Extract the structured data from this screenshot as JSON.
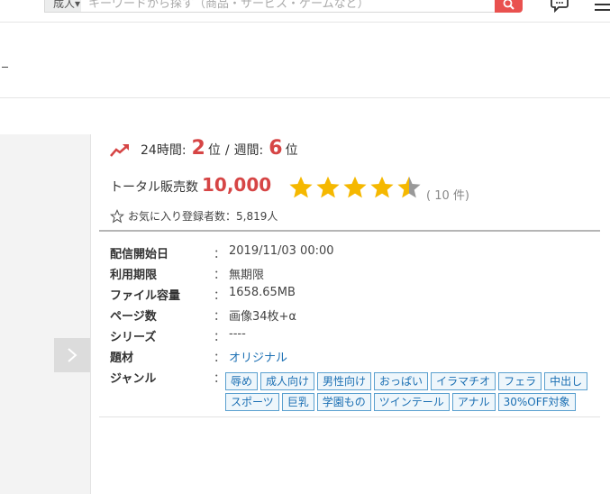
{
  "header": {
    "scope_label": "成人▾",
    "search_placeholder": "キーワードから探す（商品・サービス・ゲームなど）"
  },
  "ranking": {
    "label_24h": "24時間:",
    "rank_24h": "2",
    "unit": "位",
    "separator": "/",
    "label_week": "週間:",
    "rank_week": "6"
  },
  "sales": {
    "label": "トータル販売数",
    "value": "10,000"
  },
  "rating": {
    "stars": 4.5,
    "max_stars": 5,
    "review_count_text": "( 10 件)",
    "star_color": "#f5b800"
  },
  "favorites": {
    "text": "お気に入り登録者数：5,819人"
  },
  "details": {
    "colon": "：",
    "rows": [
      {
        "key": "配信開始日",
        "value": "2019/11/03 00:00"
      },
      {
        "key": "利用期限",
        "value": "無期限"
      },
      {
        "key": "ファイル容量",
        "value": "1658.65MB"
      },
      {
        "key": "ページ数",
        "value": "画像34枚+α"
      },
      {
        "key": "シリーズ",
        "value": "----"
      },
      {
        "key": "題材",
        "value": "オリジナル"
      },
      {
        "key": "ジャンル",
        "value": ""
      }
    ]
  },
  "genres": [
    "辱め",
    "成人向け",
    "男性向け",
    "おっぱい",
    "イラマチオ",
    "フェラ",
    "中出し",
    "スポーツ",
    "巨乳",
    "学園もの",
    "ツインテール",
    "アナル",
    "30%OFF対象"
  ],
  "colors": {
    "accent_red": "#d64545",
    "search_button": "#e9514f",
    "link_blue": "#1b6fb3"
  }
}
